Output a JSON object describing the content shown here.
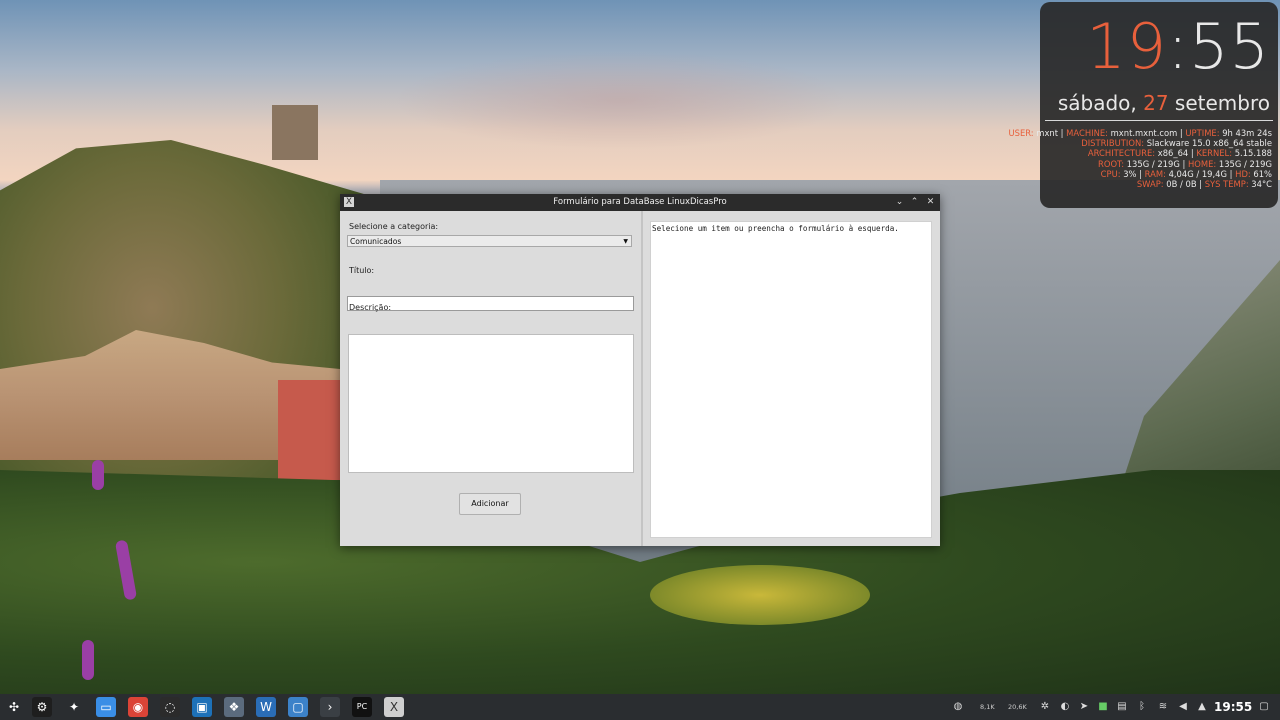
{
  "conky": {
    "hour": "19",
    "colon": ":",
    "minute": "55",
    "weekday": "sábado,",
    "day": "27",
    "month": "setembro",
    "accent_color": "#e8603c",
    "lines": [
      [
        {
          "k": "USER: ",
          "v": "mxnt"
        },
        {
          "v": " | "
        },
        {
          "k": "MACHINE: ",
          "v": "mxnt.mxnt.com"
        },
        {
          "v": " | "
        },
        {
          "k": "UPTIME: ",
          "v": "9h 43m 24s"
        }
      ],
      [
        {
          "k": "DISTRIBUTION: ",
          "v": "Slackware 15.0 x86_64 stable"
        }
      ],
      [
        {
          "k": "ARCHITECTURE: ",
          "v": "x86_64"
        },
        {
          "v": " | "
        },
        {
          "k": "KERNEL: ",
          "v": "5.15.188"
        }
      ],
      [
        {
          "k": "ROOT: ",
          "v": "135G / 219G"
        },
        {
          "v": " | "
        },
        {
          "k": "HOME: ",
          "v": "135G / 219G"
        }
      ],
      [
        {
          "k": "CPU: ",
          "v": "3%"
        },
        {
          "v": " | "
        },
        {
          "k": "RAM: ",
          "v": "4,04G / 19,4G"
        },
        {
          "v": " | "
        },
        {
          "k": "HD: ",
          "v": "61%"
        }
      ],
      [
        {
          "k": "SWAP: ",
          "v": "0B / 0B"
        },
        {
          "v": " | "
        },
        {
          "k": "SYS TEMP: ",
          "v": "34°C"
        }
      ]
    ]
  },
  "window": {
    "title": "Formulário para DataBase LinuxDicasPro",
    "app_icon": "X",
    "controls": {
      "minimize": "⌄",
      "maximize": "⌃",
      "close": "✕"
    },
    "category_label": "Selecione a categoria:",
    "category_value": "Comunicados",
    "title_label": "Título:",
    "title_value": "",
    "description_label": "Descrição:",
    "description_value": "",
    "add_button": "Adicionar",
    "output_text": "Selecione um item ou preencha o formulário à esquerda."
  },
  "taskbar": {
    "apps": [
      {
        "name": "app-launcher-icon",
        "glyph": "✣",
        "bg": "transparent"
      },
      {
        "name": "chatgpt-icon",
        "glyph": "⚙",
        "bg": "#1e1e1e"
      },
      {
        "name": "gemini-icon",
        "glyph": "✦",
        "bg": "transparent"
      },
      {
        "name": "file-manager-icon",
        "glyph": "▭",
        "bg": "#3a8ee6"
      },
      {
        "name": "chrome-icon",
        "glyph": "◉",
        "bg": "#db4437"
      },
      {
        "name": "obs-icon",
        "glyph": "◌",
        "bg": "#2b2b2b"
      },
      {
        "name": "virtualbox-icon",
        "glyph": "▣",
        "bg": "#1d71b8"
      },
      {
        "name": "software-icon",
        "glyph": "❖",
        "bg": "#5b6b7d"
      },
      {
        "name": "writer-icon",
        "glyph": "W",
        "bg": "#2a6db6"
      },
      {
        "name": "remote-desktop-icon",
        "glyph": "▢",
        "bg": "#3c82c9"
      },
      {
        "name": "terminal-icon",
        "glyph": "›",
        "bg": "#3a3f44"
      },
      {
        "name": "pycharm-icon",
        "glyph": "PC",
        "bg": "#111"
      },
      {
        "name": "tkinter-app-icon",
        "glyph": "X",
        "bg": "#cfcfcf"
      }
    ],
    "tray": {
      "net_up": "8,1K",
      "net_down": "20,6K",
      "clock": "19:55"
    }
  }
}
